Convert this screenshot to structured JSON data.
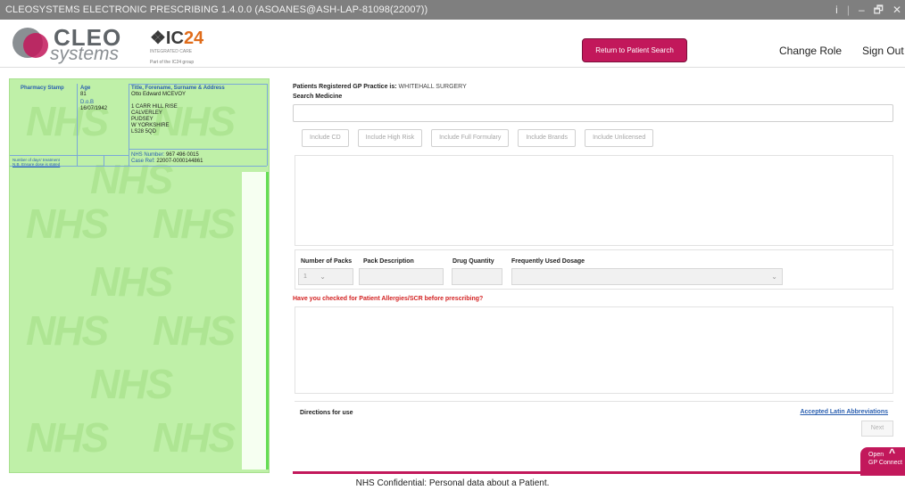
{
  "window": {
    "title": "CLEOSYSTEMS ELECTRONIC PRESCRIBING 1.4.0.0 (ASOANES@ASH-LAP-81098(22007))",
    "controls": {
      "info": "i",
      "minimize": "–",
      "maximize": "🗗",
      "close": "✕"
    }
  },
  "header": {
    "logo_line1": "CLEO",
    "logo_line2": "systems",
    "partner_logo": {
      "mark_prefix": "❖IC",
      "mark_suffix": "24",
      "tagline": "INTEGRATED CARE",
      "sub": "Part of the IC24 group"
    },
    "return_button": "Return to Patient Search",
    "change_role": "Change Role",
    "sign_out": "Sign Out"
  },
  "prescription": {
    "watermark": "NHS",
    "pharmacy_stamp": "Pharmacy Stamp",
    "age_label": "Age",
    "age": "81",
    "dob_label": "D.o.B",
    "dob": "16/07/1942",
    "name_label": "Title, Forename, Surname & Address",
    "name": "Otto Edward MCEVOY",
    "address": [
      "1 CARR HILL RISE",
      "CALVERLEY",
      "PUDSEY",
      "W YORKSHIRE",
      "LS28 5QD"
    ],
    "days_label": "Number of days' treatment",
    "days_note": "N.B. Ensure dose is stated",
    "nhs_number_label": "NHS Number:",
    "nhs_number": "967 496 0015",
    "case_ref_label": "Case Ref:",
    "case_ref": "22007-0000144861"
  },
  "main": {
    "gp_prefix": "Patients Registered GP Practice is:",
    "gp_value": "WHITEHALL SURGERY",
    "search_label": "Search Medicine",
    "search_value": "",
    "filters": [
      "Include CD",
      "Include High Risk",
      "Include Full Formulary",
      "Include Brands",
      "Include Unlicensed"
    ],
    "packs_label": "Number of Packs",
    "packs_value": "1",
    "pack_desc_label": "Pack Description",
    "drug_qty_label": "Drug Quantity",
    "dosage_label": "Frequently Used Dosage",
    "allergy_warning": "Have you checked for Patient Allergies/SCR before prescribing?",
    "directions_label": "Directions for use",
    "latin_link": "Accepted Latin Abbreviations",
    "next_button": "Next"
  },
  "gp_connect": {
    "line1": "Open",
    "line2": "GP Connect",
    "arrow": "^"
  },
  "footer": "NHS Confidential: Personal data about a Patient."
}
